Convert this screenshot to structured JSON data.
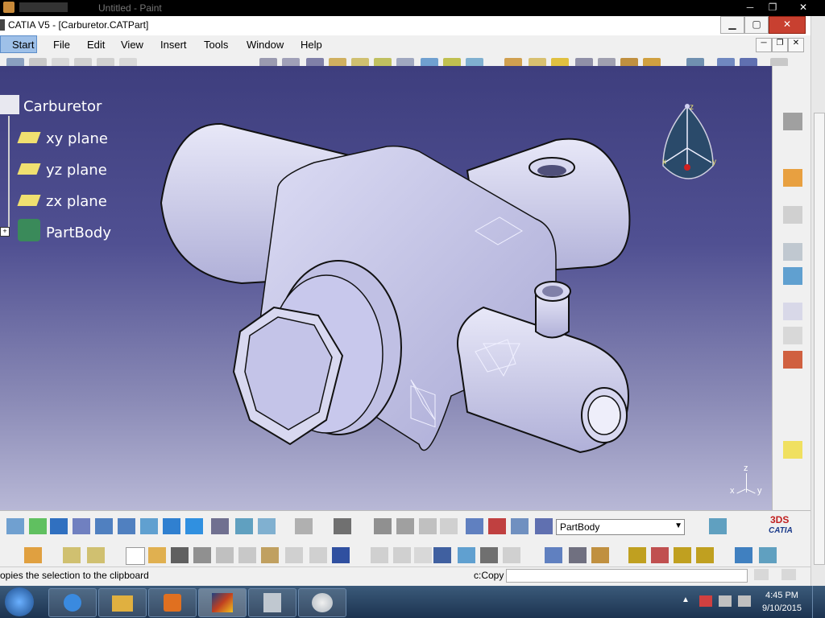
{
  "paint": {
    "title": "Untitled - Paint"
  },
  "window": {
    "title": "CATIA V5 - [Carburetor.CATPart]"
  },
  "menu": {
    "items": [
      "Start",
      "File",
      "Edit",
      "View",
      "Insert",
      "Tools",
      "Window",
      "Help"
    ]
  },
  "tree": {
    "root": "Carburetor",
    "children": [
      "xy plane",
      "yz plane",
      "zx plane",
      "PartBody"
    ]
  },
  "compass": {
    "z": "z",
    "x": "x",
    "y": "y"
  },
  "axis": {
    "z": "z",
    "x": "x",
    "y": "y"
  },
  "toolbar": {
    "part_select_value": "PartBody"
  },
  "brand": {
    "logo": "CATIA"
  },
  "status": {
    "message": "opies the selection to the clipboard",
    "command": "c:Copy"
  },
  "clock": {
    "time": "4:45 PM",
    "date": "9/10/2015"
  },
  "colors": {
    "viewport_top": "#3e3e7e",
    "viewport_bottom": "#b8b8d6",
    "part": "#c8c8ec",
    "taskbar": "#1c3350"
  }
}
